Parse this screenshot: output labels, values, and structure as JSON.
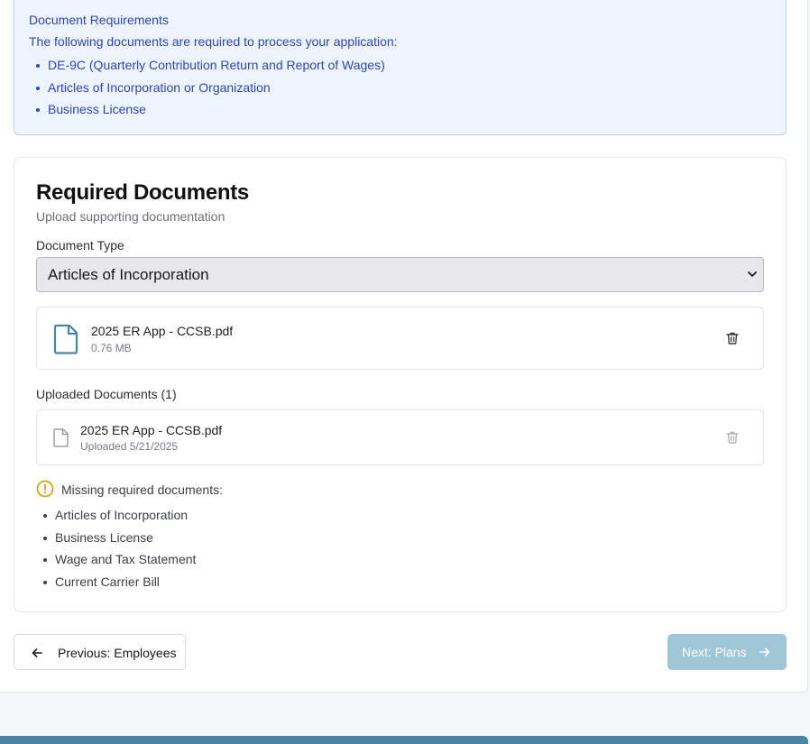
{
  "requirements": {
    "title": "Document Requirements",
    "intro": "The following documents are required to process your application:",
    "items": [
      "DE-9C (Quarterly Contribution Return and Report of Wages)",
      "Articles of Incorporation or Organization",
      "Business License"
    ]
  },
  "card": {
    "title": "Required Documents",
    "subtitle": "Upload supporting documentation",
    "doc_type_label": "Document Type",
    "doc_type_value": "Articles of Incorporation",
    "selected_file": {
      "name": "2025 ER App - CCSB.pdf",
      "size": "0.76 MB"
    },
    "uploaded_label": "Uploaded Documents (1)",
    "uploaded": [
      {
        "name": "2025 ER App - CCSB.pdf",
        "meta": "Uploaded 5/21/2025"
      }
    ],
    "missing_label": "Missing required documents:",
    "missing": [
      "Articles of Incorporation",
      "Business License",
      "Wage and Tax Statement",
      "Current Carrier Bill"
    ]
  },
  "nav": {
    "prev_label": "Previous: Employees",
    "next_label": "Next: Plans"
  },
  "colors": {
    "info_bg": "#eef4fd",
    "info_text": "#2e45b5",
    "file_icon": "#4a86a3",
    "warning": "#d4a514",
    "next_disabled": "#9fc6d6"
  },
  "icons": {
    "file": "file-icon",
    "trash": "trash-icon",
    "warning": "alert-circle-icon",
    "prev": "arrow-left-icon",
    "next": "arrow-right-icon",
    "select": "chevron-down-icon"
  }
}
